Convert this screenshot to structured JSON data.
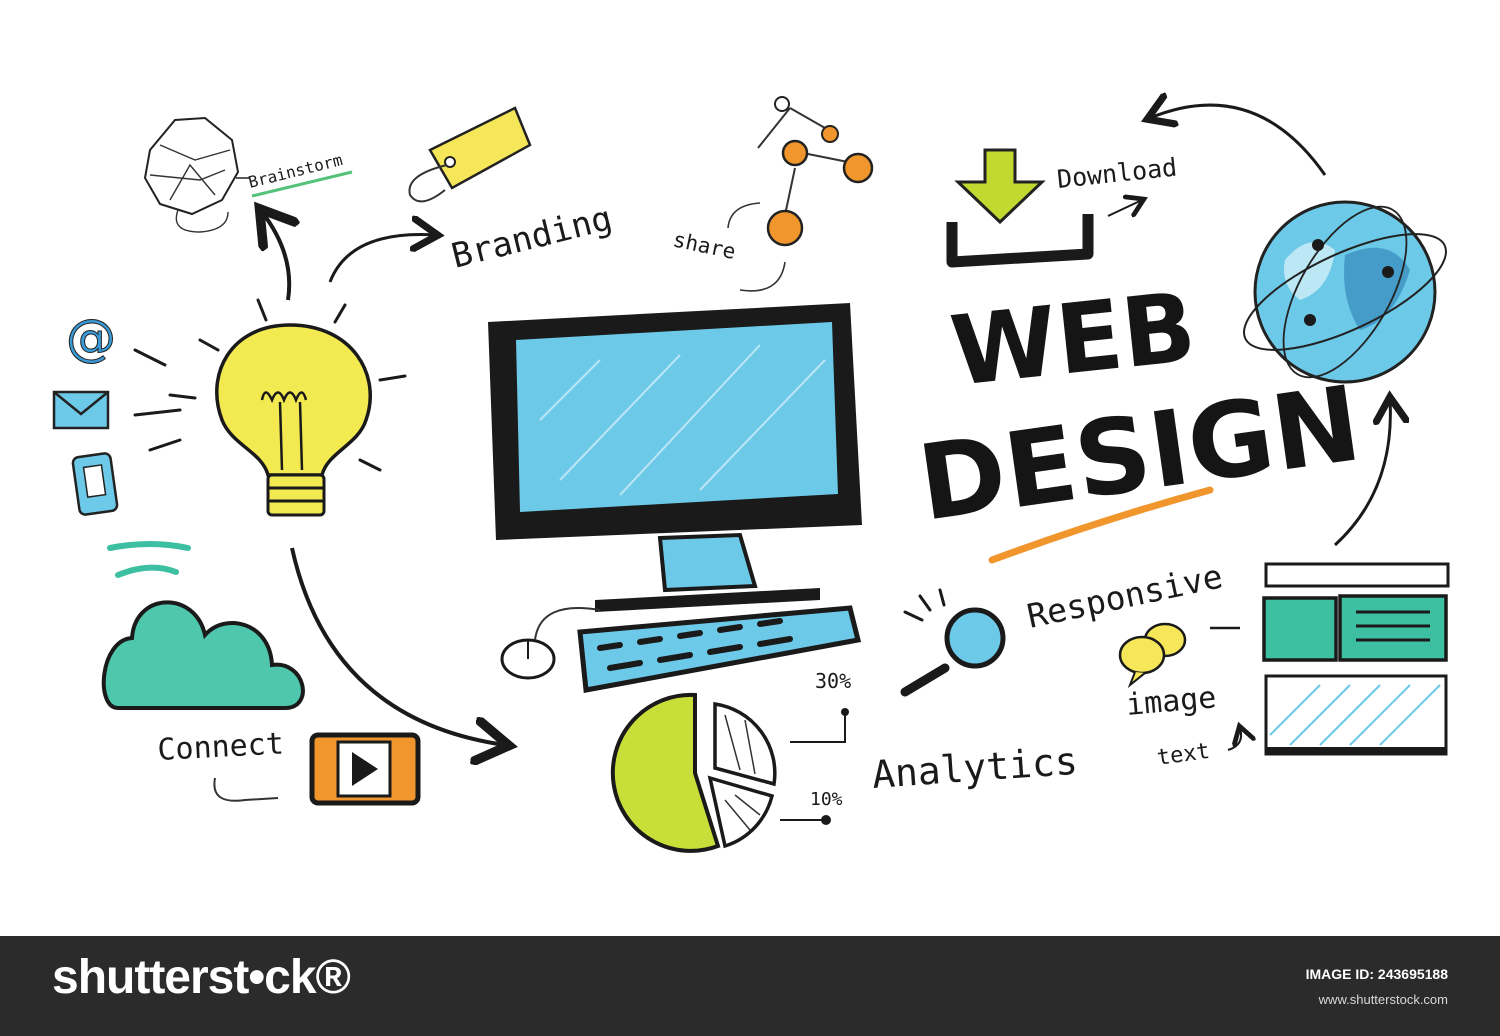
{
  "labels": {
    "brainstorm": "Brainstorm",
    "branding": "Branding",
    "share": "share",
    "download": "Download",
    "title_line1": "WEB",
    "title_line2": "DESIGN",
    "responsive": "Responsive",
    "connect": "Connect",
    "analytics": "Analytics",
    "pct_30": "30%",
    "pct_10": "10%",
    "image": "image",
    "text": "text"
  },
  "icons": [
    "at-sign-icon",
    "mail-icon",
    "phone-icon",
    "lightbulb-icon",
    "crumpled-paper-icon",
    "price-tag-icon",
    "share-network-icon",
    "download-icon",
    "globe-icon",
    "cloud-icon",
    "play-icon",
    "computer-icon",
    "keyboard-icon",
    "mouse-icon",
    "pie-chart-icon",
    "magnifier-icon",
    "speech-bubble-icon",
    "layout-wireframe-icon"
  ],
  "colors": {
    "monitor_blue": "#6cc9e8",
    "bulb_yellow": "#f3ea52",
    "accent_orange": "#f0962c",
    "pie_green": "#c8df3a",
    "cloud_teal": "#3dbfa1",
    "footer_bg": "#2b2b2b"
  },
  "footer": {
    "logo": "shutterst•ck®",
    "image_id": "IMAGE ID: 243695188",
    "site": "www.shutterstock.com"
  }
}
